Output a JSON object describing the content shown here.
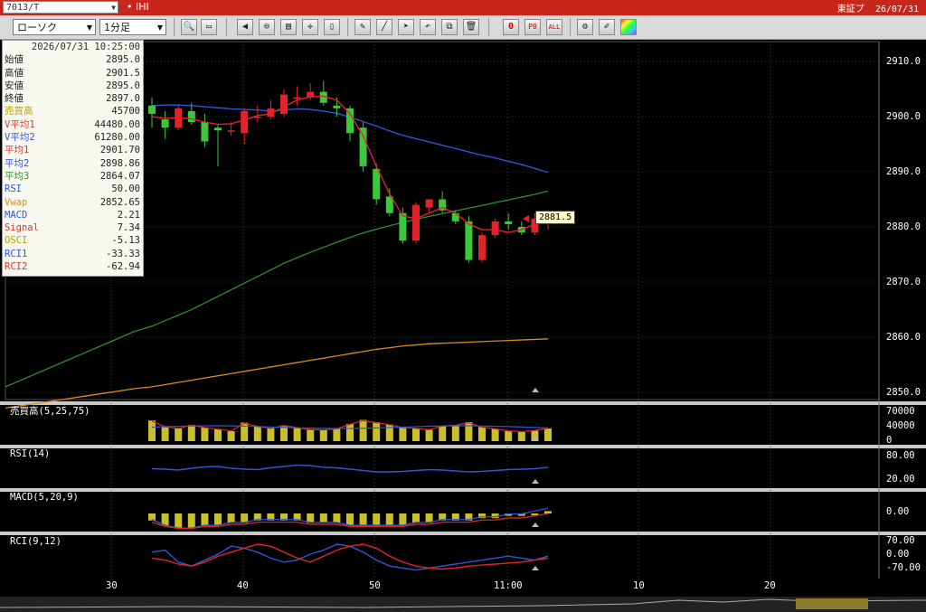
{
  "titlebar": {
    "symbol": "7013/T",
    "name_marker": "•",
    "name": "IHI",
    "market": "東証プ",
    "date": "26/07/31"
  },
  "toolbar": {
    "chart_type": "ローソク",
    "interval": "1分足",
    "buttons": [
      "zoom-in",
      "zoom-out",
      "scroll-left",
      "scroll-mid",
      "scroll-right",
      "line-draw",
      "trendline",
      "pointer",
      "undo",
      "copy",
      "delete",
      "reset-0",
      "period-0",
      "all",
      "settings",
      "pen",
      "color"
    ]
  },
  "info_panel": {
    "header": "2026/07/31  10:25:00",
    "rows": [
      {
        "label": "始値",
        "value": "2895.0",
        "color": "#222"
      },
      {
        "label": "高値",
        "value": "2901.5",
        "color": "#222"
      },
      {
        "label": "安値",
        "value": "2895.0",
        "color": "#222"
      },
      {
        "label": "終値",
        "value": "2897.0",
        "color": "#222"
      },
      {
        "label": "売買高",
        "value": "45700",
        "color": "#b8a300"
      },
      {
        "label": "V平均1",
        "value": "44480.00",
        "color": "#d23b2b"
      },
      {
        "label": "V平均2",
        "value": "61280.00",
        "color": "#3056d4"
      },
      {
        "label": "平均1",
        "value": "2901.70",
        "color": "#d23b2b"
      },
      {
        "label": "平均2",
        "value": "2898.86",
        "color": "#3056d4"
      },
      {
        "label": "平均3",
        "value": "2864.07",
        "color": "#2f8f2f"
      },
      {
        "label": "RSI",
        "value": "50.00",
        "color": "#3056d4"
      },
      {
        "label": "Vwap",
        "value": "2852.65",
        "color": "#d98a1b"
      },
      {
        "label": "MACD",
        "value": "2.21",
        "color": "#3056d4"
      },
      {
        "label": "Signal",
        "value": "7.34",
        "color": "#d23b2b"
      },
      {
        "label": "OSCI",
        "value": "-5.13",
        "color": "#b8a300"
      },
      {
        "label": "RCI1",
        "value": "-33.33",
        "color": "#3056d4"
      },
      {
        "label": "RCI2",
        "value": "-62.94",
        "color": "#d23b2b"
      }
    ]
  },
  "last_price": "2881.5",
  "price_axis": [
    "2910.0",
    "2900.0",
    "2890.0",
    "2880.0",
    "2870.0",
    "2860.0",
    "2850.0"
  ],
  "time_axis": [
    "30",
    "40",
    "50",
    "11:00",
    "10",
    "20"
  ],
  "panels": {
    "volume": {
      "title": "売買高(5,25,75)",
      "ticks": [
        "70000",
        "40000",
        "0"
      ]
    },
    "rsi": {
      "title": "RSI(14)",
      "ticks": [
        "80.00",
        "20.00"
      ]
    },
    "macd": {
      "title": "MACD(5,20,9)",
      "ticks": [
        "0.00"
      ]
    },
    "rci": {
      "title": "RCI(9,12)",
      "ticks": [
        "70.00",
        "0.00",
        "-70.00"
      ]
    }
  },
  "chart_data": {
    "type": "candlestick",
    "candles": [
      {
        "o": 2902.0,
        "h": 2903.5,
        "l": 2898.0,
        "c": 2900.5
      },
      {
        "o": 2899.5,
        "h": 2901.0,
        "l": 2896.0,
        "c": 2898.0
      },
      {
        "o": 2898.0,
        "h": 2902.0,
        "l": 2897.5,
        "c": 2901.5
      },
      {
        "o": 2901.0,
        "h": 2902.5,
        "l": 2898.5,
        "c": 2899.0
      },
      {
        "o": 2899.0,
        "h": 2900.5,
        "l": 2894.5,
        "c": 2895.5
      },
      {
        "o": 2898.0,
        "h": 2898.5,
        "l": 2891.0,
        "c": 2897.5
      },
      {
        "o": 2897.5,
        "h": 2899.0,
        "l": 2896.5,
        "c": 2897.5
      },
      {
        "o": 2897.0,
        "h": 2901.5,
        "l": 2895.0,
        "c": 2901.0
      },
      {
        "o": 2900.0,
        "h": 2902.0,
        "l": 2899.0,
        "c": 2900.0
      },
      {
        "o": 2900.0,
        "h": 2903.0,
        "l": 2899.5,
        "c": 2901.5
      },
      {
        "o": 2900.5,
        "h": 2905.0,
        "l": 2900.0,
        "c": 2904.0
      },
      {
        "o": 2903.5,
        "h": 2905.5,
        "l": 2902.0,
        "c": 2903.5
      },
      {
        "o": 2903.5,
        "h": 2906.0,
        "l": 2903.0,
        "c": 2904.5
      },
      {
        "o": 2904.5,
        "h": 2906.5,
        "l": 2902.0,
        "c": 2902.5
      },
      {
        "o": 2902.0,
        "h": 2903.5,
        "l": 2900.0,
        "c": 2901.5
      },
      {
        "o": 2901.5,
        "h": 2902.0,
        "l": 2895.5,
        "c": 2897.0
      },
      {
        "o": 2898.0,
        "h": 2899.0,
        "l": 2890.0,
        "c": 2891.0
      },
      {
        "o": 2890.5,
        "h": 2891.5,
        "l": 2884.0,
        "c": 2885.0
      },
      {
        "o": 2885.5,
        "h": 2887.0,
        "l": 2882.0,
        "c": 2882.5
      },
      {
        "o": 2882.5,
        "h": 2883.5,
        "l": 2877.0,
        "c": 2877.5
      },
      {
        "o": 2877.5,
        "h": 2884.5,
        "l": 2877.0,
        "c": 2884.0
      },
      {
        "o": 2883.5,
        "h": 2885.0,
        "l": 2882.5,
        "c": 2885.0
      },
      {
        "o": 2885.0,
        "h": 2886.5,
        "l": 2882.5,
        "c": 2883.0
      },
      {
        "o": 2882.5,
        "h": 2883.0,
        "l": 2880.5,
        "c": 2881.0
      },
      {
        "o": 2881.0,
        "h": 2882.0,
        "l": 2873.5,
        "c": 2874.0
      },
      {
        "o": 2874.0,
        "h": 2879.0,
        "l": 2873.5,
        "c": 2878.5
      },
      {
        "o": 2878.5,
        "h": 2881.5,
        "l": 2878.0,
        "c": 2881.0
      },
      {
        "o": 2881.0,
        "h": 2882.5,
        "l": 2879.5,
        "c": 2880.5
      },
      {
        "o": 2880.0,
        "h": 2881.0,
        "l": 2878.5,
        "c": 2879.0
      },
      {
        "o": 2879.0,
        "h": 2882.5,
        "l": 2878.5,
        "c": 2881.5
      },
      {
        "o": 2881.0,
        "h": 2882.5,
        "l": 2879.5,
        "c": 2882.0
      }
    ],
    "ma1": [
      2900.0,
      2899.7,
      2899.8,
      2899.6,
      2899.0,
      2898.6,
      2898.7,
      2899.4,
      2900.2,
      2900.5,
      2901.8,
      2903.0,
      2903.6,
      2903.7,
      2903.0,
      2900.5,
      2896.5,
      2891.0,
      2886.0,
      2882.0,
      2881.5,
      2882.5,
      2883.5,
      2882.5,
      2880.5,
      2879.5,
      2879.5,
      2879.0,
      2879.5,
      2880.5,
      2881.5
    ],
    "ma2": [
      2902.0,
      2902.1,
      2902.1,
      2902.0,
      2901.8,
      2901.6,
      2901.4,
      2901.3,
      2901.2,
      2901.0,
      2901.2,
      2901.4,
      2901.3,
      2901.0,
      2900.6,
      2899.9,
      2899.1,
      2898.3,
      2897.4,
      2896.6,
      2896.0,
      2895.4,
      2894.8,
      2894.2,
      2893.6,
      2893.0,
      2892.5,
      2891.9,
      2891.3,
      2890.6,
      2889.9
    ],
    "ma3": [
      2862.0,
      2863.0,
      2864.0,
      2865.0,
      2866.2,
      2867.4,
      2868.6,
      2869.8,
      2871.0,
      2872.2,
      2873.4,
      2874.4,
      2875.4,
      2876.3,
      2877.2,
      2878.1,
      2878.9,
      2879.6,
      2880.2,
      2880.8,
      2881.4,
      2881.9,
      2882.4,
      2882.9,
      2883.4,
      2883.9,
      2884.4,
      2884.9,
      2885.4,
      2885.9,
      2886.5
    ],
    "vwap": [
      2851.0,
      2851.4,
      2851.8,
      2852.2,
      2852.6,
      2853.0,
      2853.4,
      2853.8,
      2854.2,
      2854.6,
      2855.0,
      2855.4,
      2855.8,
      2856.2,
      2856.6,
      2857.0,
      2857.4,
      2857.8,
      2858.1,
      2858.4,
      2858.6,
      2858.8,
      2858.9,
      2859.0,
      2859.1,
      2859.2,
      2859.3,
      2859.4,
      2859.5,
      2859.6,
      2859.7
    ],
    "volume": [
      45700,
      32000,
      28000,
      36000,
      30000,
      26000,
      22000,
      41000,
      33000,
      28000,
      35000,
      30000,
      25000,
      24000,
      27000,
      38000,
      47000,
      42000,
      37000,
      30000,
      28000,
      25000,
      34000,
      36000,
      42000,
      31000,
      27000,
      22000,
      20000,
      23000,
      28000
    ],
    "rsi": [
      47,
      46,
      44,
      48,
      51,
      52,
      48,
      46,
      45,
      49,
      52,
      55,
      54,
      50,
      49,
      46,
      43,
      40,
      40,
      41,
      43,
      45,
      44,
      42,
      40,
      41,
      43,
      45,
      46,
      47,
      50
    ],
    "macd_hist": [
      -3,
      -5,
      -6,
      -6,
      -5,
      -5,
      -4,
      -4,
      -3,
      -3,
      -3,
      -3,
      -4,
      -4,
      -4,
      -5,
      -5,
      -5,
      -5,
      -5,
      -4,
      -4,
      -3,
      -3,
      -3,
      -2,
      -2,
      -1,
      -1,
      0,
      1
    ],
    "rci1": [
      10,
      20,
      -40,
      -60,
      -30,
      0,
      40,
      30,
      10,
      -20,
      -40,
      -30,
      0,
      20,
      50,
      40,
      10,
      -30,
      -60,
      -70,
      -80,
      -70,
      -60,
      -50,
      -40,
      -30,
      -20,
      -10,
      -20,
      -30,
      -10
    ],
    "rci2": [
      -20,
      -30,
      -50,
      -60,
      -40,
      -10,
      10,
      30,
      50,
      40,
      10,
      -20,
      -40,
      -10,
      20,
      40,
      50,
      30,
      -10,
      -40,
      -60,
      -70,
      -75,
      -70,
      -60,
      -55,
      -50,
      -45,
      -40,
      -30,
      -20
    ]
  }
}
